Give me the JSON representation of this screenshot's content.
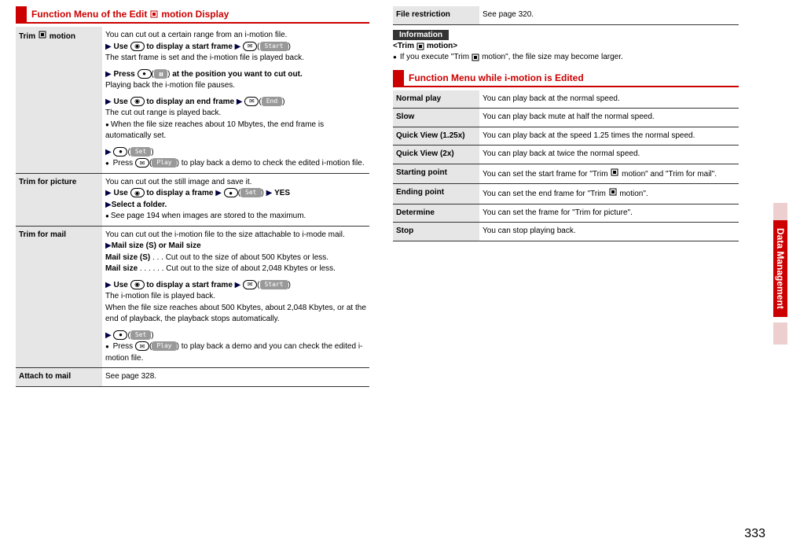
{
  "header1": {
    "prefix": "Function Menu of the Edit",
    "suffix": "motion Display"
  },
  "left": [
    {
      "label": {
        "l1": "Trim",
        "l2": "motion"
      },
      "desc": {
        "p1": "You can cut out a certain range from an i-motion file.",
        "p2a": "Use",
        "p2b": "to display a start frame",
        "p3": "The start frame is set and the i-motion file is played back.",
        "p4a": "Press",
        "p4b": "at the position you want to cut out.",
        "p5": "Playing back the i-motion file pauses.",
        "p6a": "Use",
        "p6b": "to display an end frame",
        "p7": "The cut out range is played back.",
        "p8": "When the file size reaches about 10 Mbytes, the end frame is automatically set.",
        "p9a": "Press",
        "p9b": "to play back a demo to check the edited i-motion file.",
        "chipStart": "Start",
        "chipEnd": "End",
        "chipSet": "Set",
        "chipPlay": "Play",
        "chipPause": "❚❚"
      }
    },
    {
      "label": "Trim for picture",
      "desc": {
        "p1": "You can cut out the still image and save it.",
        "p2a": "Use",
        "p2b": "to display a frame",
        "p2c": "YES",
        "p3": "Select a folder.",
        "p4": "See page 194 when images are stored to the maximum.",
        "chipSet": "Set"
      }
    },
    {
      "label": "Trim for mail",
      "desc": {
        "p1": "You can cut out the i-motion file to the size attachable to i-mode mail.",
        "p2": "Mail size (S) or Mail size",
        "p3a": "Mail size (S)",
        "p3b": ". . .  Cut out to the size of about 500 Kbytes or less.",
        "p4a": "Mail size",
        "p4b": ". . . . . .  Cut out to the size of about 2,048 Kbytes or less.",
        "p5a": "Use",
        "p5b": "to display a start frame",
        "p6": "The i-motion file is played back.",
        "p7": "When the file size reaches about 500 Kbytes, about 2,048 Kbytes, or at the end of playback, the playback stops automatically.",
        "p8a": "Press",
        "p8b": "to play back a demo and you can check the edited i-motion file.",
        "chipStart": "Start",
        "chipSet": "Set",
        "chipPlay": "Play"
      }
    },
    {
      "label": "Attach to mail",
      "desc": {
        "p1": "See page 328."
      }
    }
  ],
  "rightTop": [
    {
      "label": "File restriction",
      "desc": "See page 320."
    }
  ],
  "info": {
    "title": "Information",
    "sub1": "<Trim",
    "sub2": "motion>",
    "line": "If you execute \"Trim",
    "line2": "motion\", the file size may become larger."
  },
  "header2": "Function Menu while i-motion is Edited",
  "right": [
    {
      "label": "Normal play",
      "desc": "You can play back at the normal speed."
    },
    {
      "label": "Slow",
      "desc": "You can play back mute at half the normal speed."
    },
    {
      "label": "Quick View (1.25x)",
      "desc": "You can play back at the speed 1.25 times the normal speed."
    },
    {
      "label": "Quick View (2x)",
      "desc": "You can play back at twice the normal speed."
    },
    {
      "label": "Starting point",
      "desc1": "You can set the start frame for \"Trim",
      "desc2": "motion\" and \"Trim for mail\"."
    },
    {
      "label": "Ending point",
      "desc1": "You can set the end frame for \"Trim",
      "desc2": "motion\"."
    },
    {
      "label": "Determine",
      "desc": "You can set the frame for \"Trim for picture\"."
    },
    {
      "label": "Stop",
      "desc": "You can stop playing back."
    }
  ],
  "sideTab": "Data Management",
  "pageNum": "333"
}
